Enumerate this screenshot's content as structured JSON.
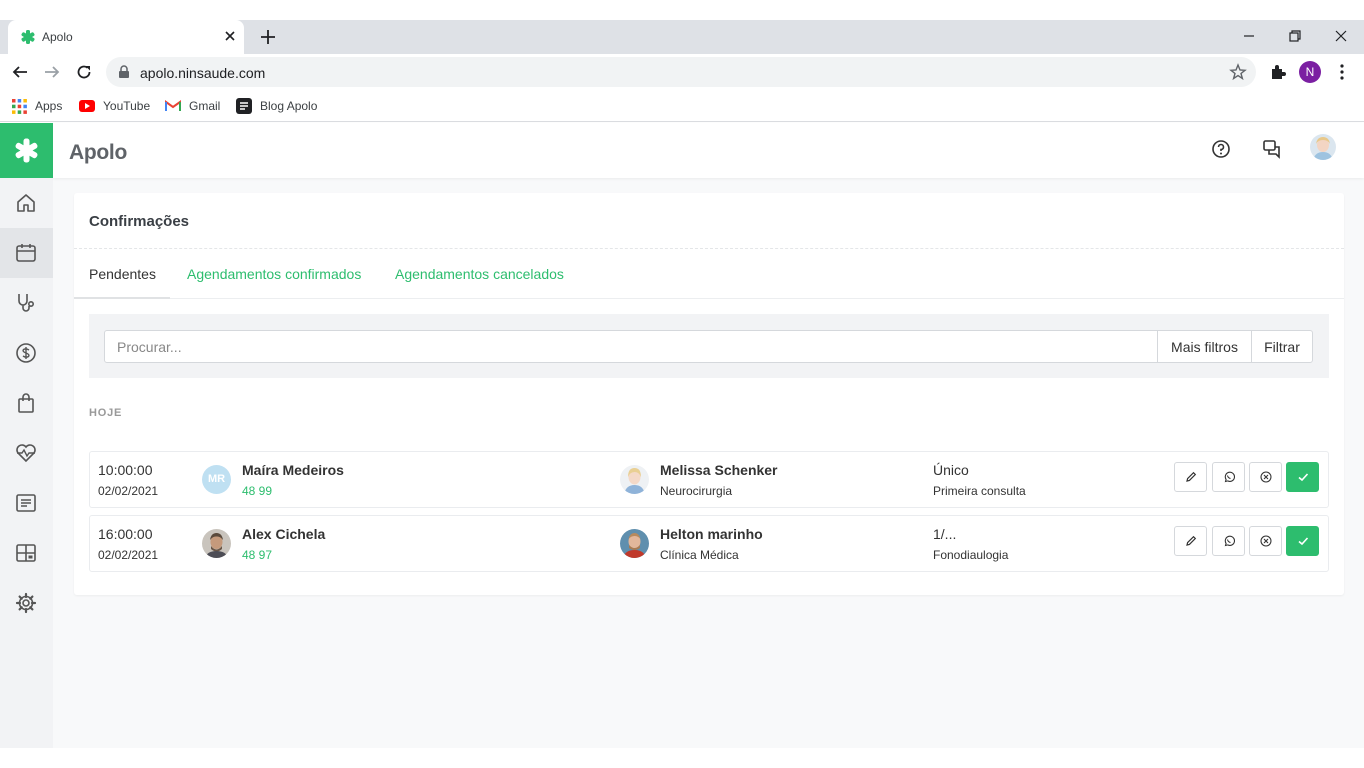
{
  "browser": {
    "tab_title": "Apolo",
    "url": "apolo.ninsaude.com",
    "profile_initial": "N",
    "bookmarks": [
      "Apps",
      "YouTube",
      "Gmail",
      "Blog Apolo"
    ]
  },
  "app": {
    "brand": "Apolo",
    "accent_color": "#2dbd6e",
    "sidebar_icons": [
      "home-icon",
      "calendar-icon",
      "stethoscope-icon",
      "dollar-icon",
      "shopping-bag-icon",
      "heartbeat-icon",
      "list-icon",
      "grid-icon",
      "gear-icon"
    ],
    "header_icons": [
      "help-icon",
      "chat-icon",
      "user-avatar"
    ]
  },
  "page": {
    "title": "Confirmações",
    "tabs": [
      {
        "label": "Pendentes",
        "active": true
      },
      {
        "label": "Agendamentos confirmados",
        "active": false
      },
      {
        "label": "Agendamentos cancelados",
        "active": false
      }
    ],
    "search": {
      "placeholder": "Procurar...",
      "value": ""
    },
    "more_filters_label": "Mais filtros",
    "filter_label": "Filtrar",
    "section_label": "HOJE"
  },
  "appointments": [
    {
      "time": "10:00:00",
      "date": "02/02/2021",
      "patient_initials": "MR",
      "patient": "Maíra Medeiros",
      "phone": "48 99",
      "doctor": "Melissa Schenker",
      "specialty": "Neurocirurgia",
      "type": "Único",
      "subtype": "Primeira consulta"
    },
    {
      "time": "16:00:00",
      "date": "02/02/2021",
      "patient_initials": "",
      "patient": "Alex Cichela",
      "phone": "48 97",
      "doctor": "Helton marinho",
      "specialty": "Clínica Médica",
      "type": "1/...",
      "subtype": "Fonodiaulogia"
    }
  ]
}
